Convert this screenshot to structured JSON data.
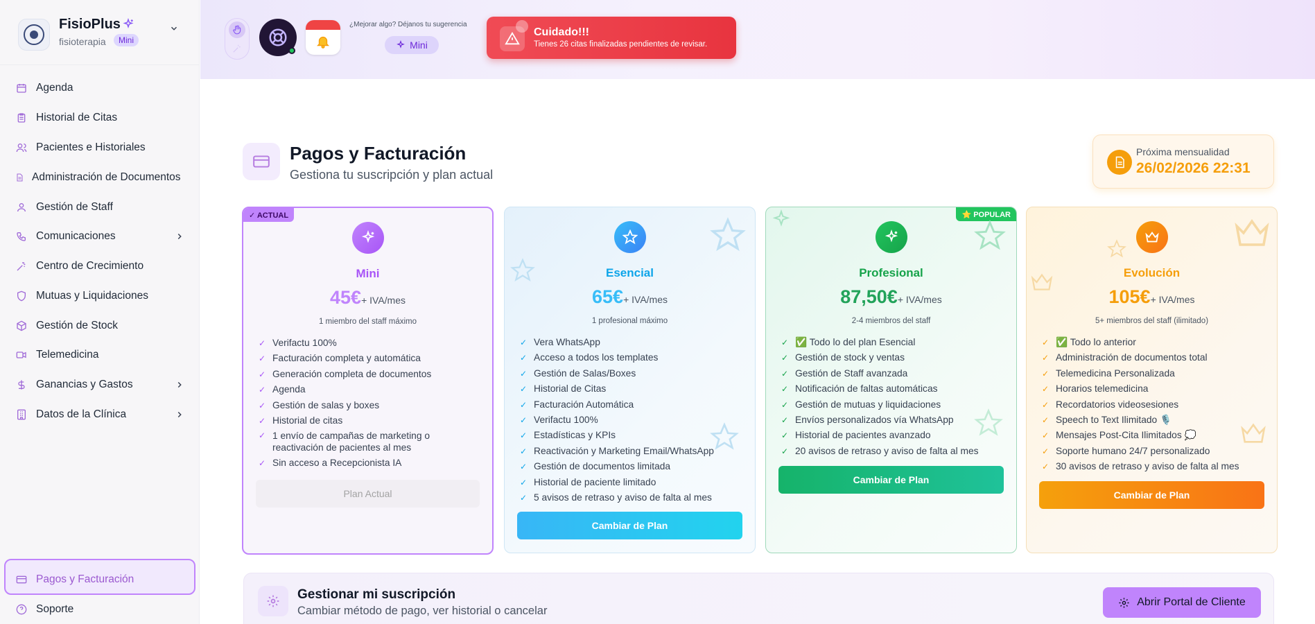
{
  "brand": {
    "name": "FisioPlus",
    "subtitle": "fisioterapia",
    "plan_badge": "Mini"
  },
  "sidebar": {
    "items": [
      {
        "label": "Agenda",
        "icon": "calendar-icon"
      },
      {
        "label": "Historial de Citas",
        "icon": "clipboard-icon"
      },
      {
        "label": "Pacientes e Historiales",
        "icon": "users-icon"
      },
      {
        "label": "Administración de Documentos",
        "icon": "document-icon"
      },
      {
        "label": "Gestión de Staff",
        "icon": "user-icon"
      },
      {
        "label": "Comunicaciones",
        "icon": "phone-icon"
      },
      {
        "label": "Centro de Crecimiento",
        "icon": "wand-icon"
      },
      {
        "label": "Mutuas y Liquidaciones",
        "icon": "shield-icon"
      },
      {
        "label": "Gestión de Stock",
        "icon": "box-icon"
      },
      {
        "label": "Telemedicina",
        "icon": "video-icon"
      },
      {
        "label": "Ganancias y Gastos",
        "icon": "dollar-icon"
      },
      {
        "label": "Datos de la Clínica",
        "icon": "building-icon"
      }
    ],
    "bottom": [
      {
        "label": "Pagos y Facturación",
        "icon": "credit-card-icon",
        "active": true
      },
      {
        "label": "Soporte",
        "icon": "help-icon"
      }
    ]
  },
  "topbar": {
    "suggestion_text": "¿Mejorar algo? Déjanos tu sugerencia",
    "plan_chip": "Mini",
    "alert": {
      "title": "Cuidado!!!",
      "message": "Tienes 26 citas finalizadas pendientes de revisar."
    }
  },
  "page": {
    "title": "Pagos y Facturación",
    "subtitle": "Gestiona tu suscripción y plan actual",
    "next_payment_label": "Próxima mensualidad",
    "next_payment_value": "26/02/2026 22:31"
  },
  "plans": [
    {
      "name": "Mini",
      "price": "45€",
      "per": "+ IVA/mes",
      "staff": "1 miembro del staff máximo",
      "tag": "✓ ACTUAL",
      "color": "#a855f7",
      "features": [
        "Verifactu 100%",
        "Facturación completa y automática",
        "Generación completa de documentos",
        "Agenda",
        "Gestión de salas y boxes",
        "Historial de citas",
        "1 envío de campañas de marketing o reactivación de pacientes al mes",
        "Sin acceso a Recepcionista IA"
      ],
      "cta": "Plan Actual"
    },
    {
      "name": "Esencial",
      "price": "65€",
      "per": "+ IVA/mes",
      "staff": "1 profesional máximo",
      "color": "#38bdf8",
      "features": [
        "Vera WhatsApp",
        "Acceso a todos los templates",
        "Gestión de Salas/Boxes",
        "Historial de Citas",
        "Facturación Automática",
        "Verifactu 100%",
        "Estadísticas y KPIs",
        "Reactivación y Marketing Email/WhatsApp",
        "Gestión de documentos limitada",
        "Historial de paciente limitado",
        "5 avisos de retraso y aviso de falta al mes"
      ],
      "cta": "Cambiar de Plan"
    },
    {
      "name": "Profesional",
      "price": "87,50€",
      "per": "+ IVA/mes",
      "staff": "2-4 miembros del staff",
      "tag": "⭐ POPULAR",
      "color": "#22c55e",
      "features": [
        "✅ Todo lo del plan Esencial",
        "Gestión de stock y ventas",
        "Gestión de Staff avanzada",
        "Notificación de faltas automáticas",
        "Gestión de mutuas y liquidaciones",
        "Envíos personalizados vía WhatsApp",
        "Historial de pacientes avanzado",
        "20 avisos de retraso y aviso de falta al mes"
      ],
      "cta": "Cambiar de Plan"
    },
    {
      "name": "Evolución",
      "price": "105€",
      "per": "+ IVA/mes",
      "staff": "5+ miembros del staff (ilimitado)",
      "color": "#f59e0b",
      "features": [
        "✅ Todo lo anterior",
        "Administración de documentos total",
        "Telemedicina Personalizada",
        "Horarios telemedicina",
        "Recordatorios videosesiones",
        "Speech to Text Ilimitado 🎙️",
        "Mensajes Post-Cita Ilimitados 💭",
        "Soporte humano 24/7 personalizado",
        "30 avisos de retraso y aviso de falta al mes"
      ],
      "cta": "Cambiar de Plan"
    }
  ],
  "manage": {
    "title": "Gestionar mi suscripción",
    "subtitle": "Cambiar método de pago, ver historial o cancelar",
    "button": "Abrir Portal de Cliente"
  }
}
